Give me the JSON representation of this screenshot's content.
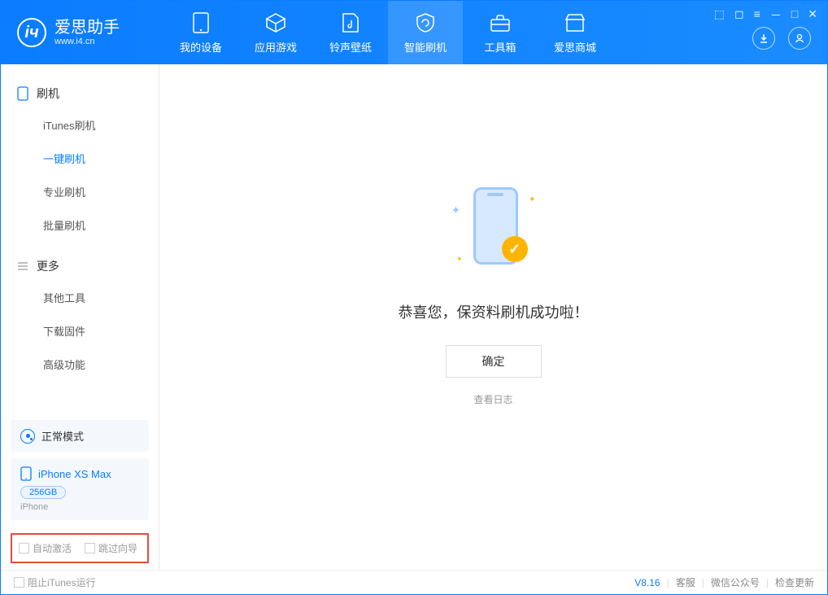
{
  "app": {
    "name": "爱思助手",
    "url": "www.i4.cn"
  },
  "nav": {
    "device": "我的设备",
    "apps": "应用游戏",
    "ringtones": "铃声壁纸",
    "flash": "智能刷机",
    "toolbox": "工具箱",
    "store": "爱思商城"
  },
  "sidebar": {
    "section_flash": "刷机",
    "itunes_flash": "iTunes刷机",
    "one_click": "一键刷机",
    "pro_flash": "专业刷机",
    "batch_flash": "批量刷机",
    "section_more": "更多",
    "other_tools": "其他工具",
    "download_fw": "下载固件",
    "advanced": "高级功能"
  },
  "mode": {
    "label": "正常模式"
  },
  "device": {
    "name": "iPhone XS Max",
    "capacity": "256GB",
    "type": "iPhone"
  },
  "options": {
    "auto_activate": "自动激活",
    "skip_guide": "跳过向导"
  },
  "main": {
    "success": "恭喜您，保资料刷机成功啦！",
    "ok": "确定",
    "view_log": "查看日志"
  },
  "footer": {
    "block_itunes": "阻止iTunes运行",
    "version": "V8.16",
    "support": "客服",
    "wechat": "微信公众号",
    "check_update": "检查更新"
  }
}
